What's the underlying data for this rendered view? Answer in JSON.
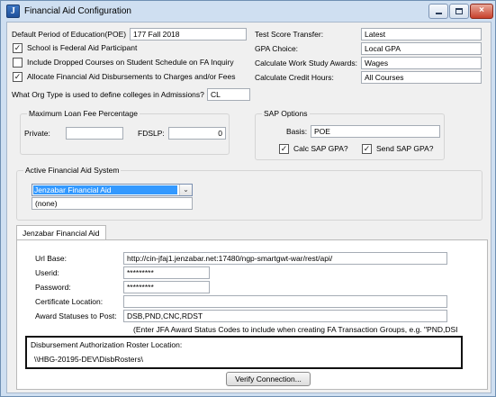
{
  "window": {
    "title": "Financial Aid Configuration",
    "icon_letter": "J",
    "controls": {
      "minimize": "minimize-icon",
      "maximize": "maximize-icon",
      "close": "×"
    }
  },
  "top": {
    "poe_label": "Default Period of Education(POE)",
    "poe_value": "177   Fall 2018",
    "school_participant_label": "School is Federal Aid Participant",
    "school_participant_checked": true,
    "include_dropped_label": "Include Dropped Courses on Student Schedule on FA Inquiry",
    "include_dropped_checked": false,
    "allocate_label": "Allocate Financial Aid Disbursements to Charges and/or Fees",
    "allocate_checked": true,
    "test_score_label": "Test Score Transfer:",
    "test_score_value": "Latest",
    "gpa_choice_label": "GPA Choice:",
    "gpa_choice_value": "Local GPA",
    "work_study_label": "Calculate Work Study Awards:",
    "work_study_value": "Wages",
    "credit_hours_label": "Calculate Credit Hours:",
    "credit_hours_value": "All Courses",
    "org_type_label": "What Org Type is used to define colleges in Admissions?",
    "org_type_value": "CL"
  },
  "loan_fee": {
    "title": "Maximum Loan Fee Percentage",
    "private_label": "Private:",
    "private_value": "",
    "fdslp_label": "FDSLP:",
    "fdslp_value": "0"
  },
  "sap": {
    "title": "SAP Options",
    "basis_label": "Basis:",
    "basis_value": "POE",
    "calc_label": "Calc SAP GPA?",
    "calc_checked": true,
    "send_label": "Send SAP GPA?",
    "send_checked": true
  },
  "active_system": {
    "title": "Active Financial Aid System",
    "selected": "Jenzabar Financial Aid",
    "list_item": "(none)"
  },
  "jfa": {
    "tab_label": "Jenzabar Financial Aid",
    "url_label": "Url Base:",
    "url_value": "http://cin-jfaj1.jenzabar.net:17480/ngp-smartgwt-war/rest/api/",
    "userid_label": "Userid:",
    "userid_value": "*********",
    "password_label": "Password:",
    "password_value": "*********",
    "cert_label": "Certificate Location:",
    "cert_value": "",
    "award_label": "Award Statuses to Post:",
    "award_value": "DSB,PND,CNC,RDST",
    "award_hint": "(Enter JFA Award Status Codes to include when creating FA Transaction Groups, e.g. \"PND,DSI",
    "roster_label": "Disbursement Authorization Roster Location:",
    "roster_value": "\\\\HBG-20195-DEV\\DisbRosters\\",
    "verify_button": "Verify Connection..."
  }
}
